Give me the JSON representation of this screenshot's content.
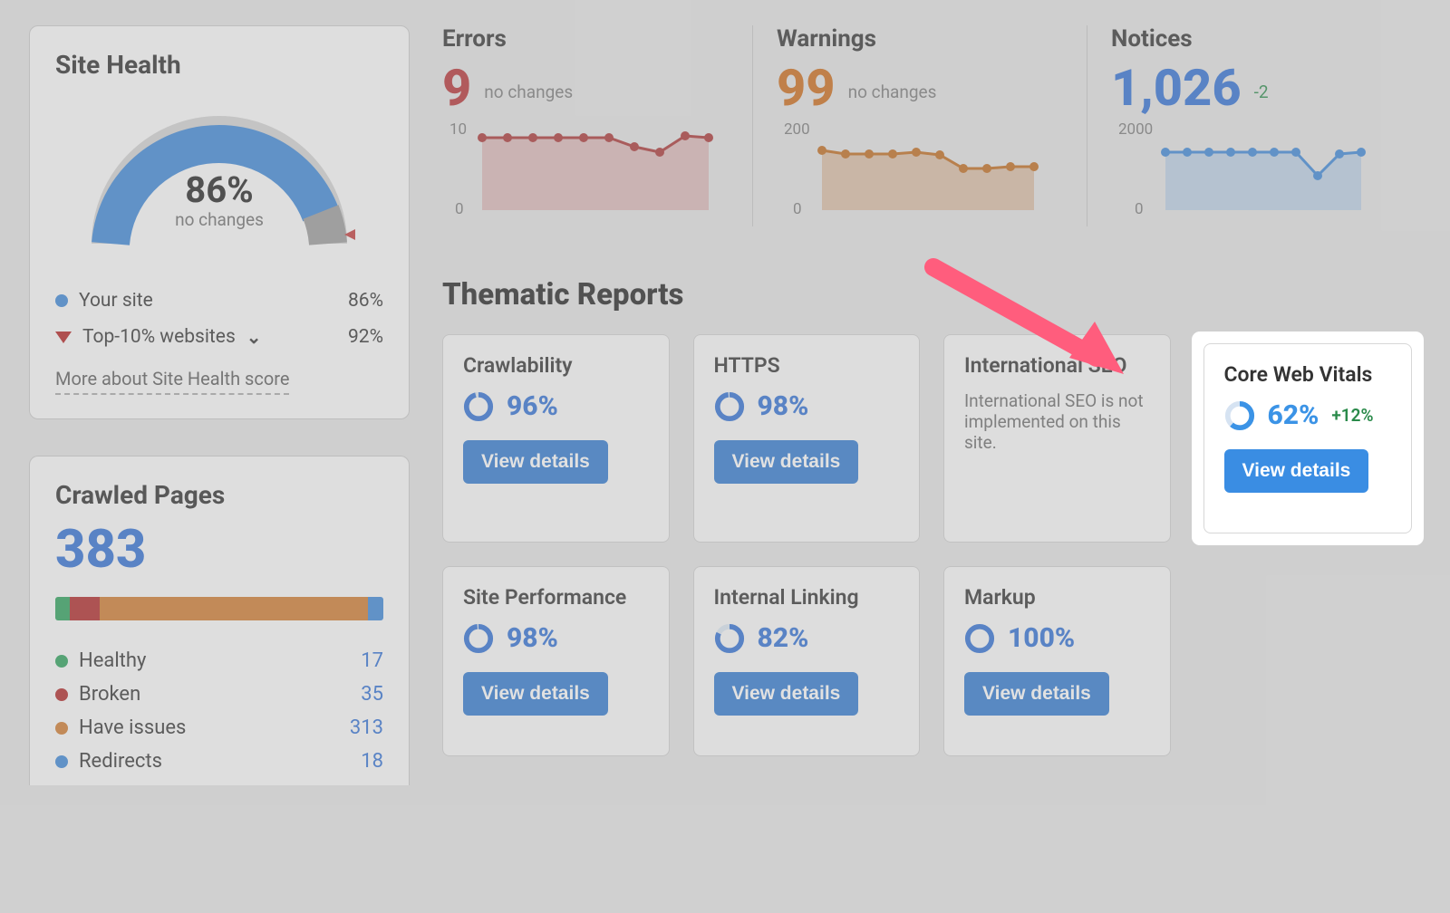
{
  "siteHealth": {
    "title": "Site Health",
    "score": "86%",
    "sub": "no changes",
    "yourSiteLabel": "Your site",
    "yourSiteValue": "86%",
    "top10Label": "Top-10% websites",
    "top10Value": "92%",
    "moreLink": "More about Site Health score"
  },
  "crawled": {
    "title": "Crawled Pages",
    "total": "383",
    "legend": {
      "healthy": {
        "label": "Healthy",
        "value": "17",
        "color": "#2aa05a"
      },
      "broken": {
        "label": "Broken",
        "value": "35",
        "color": "#b02626"
      },
      "issues": {
        "label": "Have issues",
        "value": "313",
        "color": "#cf7a2d"
      },
      "redirects": {
        "label": "Redirects",
        "value": "18",
        "color": "#3b86d7"
      }
    }
  },
  "stats": {
    "errors": {
      "title": "Errors",
      "value": "9",
      "meta": "no changes",
      "axisTop": "10",
      "axisBottom": "0"
    },
    "warnings": {
      "title": "Warnings",
      "value": "99",
      "meta": "no changes",
      "axisTop": "200",
      "axisBottom": "0"
    },
    "notices": {
      "title": "Notices",
      "value": "1,026",
      "meta": "-2",
      "axisTop": "2000",
      "axisBottom": "0"
    }
  },
  "chart_data": [
    {
      "type": "line",
      "title": "Errors",
      "ylim": [
        0,
        10
      ],
      "x": [
        1,
        2,
        3,
        4,
        5,
        6,
        7,
        8,
        9,
        10
      ],
      "values": [
        9,
        9,
        9,
        9,
        9,
        9,
        8.2,
        7.8,
        9,
        9
      ]
    },
    {
      "type": "line",
      "title": "Warnings",
      "ylim": [
        0,
        200
      ],
      "x": [
        1,
        2,
        3,
        4,
        5,
        6,
        7,
        8,
        9,
        10
      ],
      "values": [
        120,
        115,
        115,
        115,
        118,
        112,
        95,
        95,
        98,
        98
      ]
    },
    {
      "type": "line",
      "title": "Notices",
      "ylim": [
        0,
        2000
      ],
      "x": [
        1,
        2,
        3,
        4,
        5,
        6,
        7,
        8,
        9,
        10
      ],
      "values": [
        1030,
        1030,
        1030,
        1030,
        1030,
        1030,
        1030,
        820,
        1020,
        1030
      ]
    }
  ],
  "thematic": {
    "title": "Thematic Reports",
    "viewDetails": "View details",
    "cards": {
      "crawlability": {
        "title": "Crawlability",
        "pct": "96%"
      },
      "https": {
        "title": "HTTPS",
        "pct": "98%"
      },
      "intlSEO": {
        "title": "International SEO",
        "text": "International SEO is not implemented on this site."
      },
      "cwv": {
        "title": "Core Web Vitals",
        "pct": "62%",
        "delta": "+12%"
      },
      "perf": {
        "title": "Site Performance",
        "pct": "98%"
      },
      "linking": {
        "title": "Internal Linking",
        "pct": "82%"
      },
      "markup": {
        "title": "Markup",
        "pct": "100%"
      }
    }
  }
}
